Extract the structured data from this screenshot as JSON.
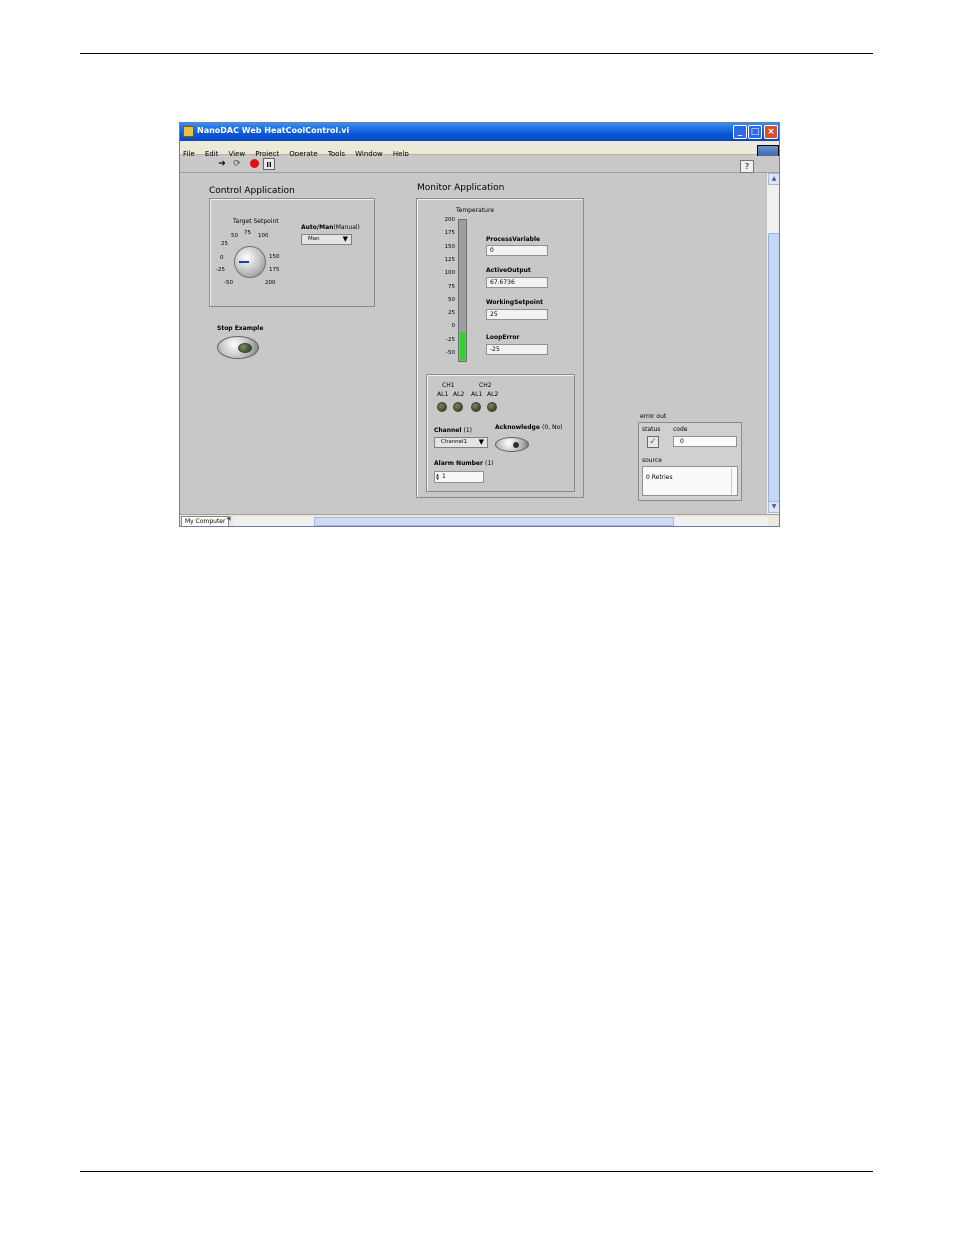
{
  "window": {
    "title": "NanoDAC Web HeatCoolControl.vi",
    "buttons": {
      "minimize": "_",
      "maximize": "□",
      "close": "×"
    }
  },
  "menu": [
    "File",
    "Edit",
    "View",
    "Project",
    "Operate",
    "Tools",
    "Window",
    "Help"
  ],
  "toolbar": {
    "run_glyph": "➔",
    "run_cont_glyph": "⟳",
    "pause_glyph": "II",
    "help_glyph": "?"
  },
  "control_app": {
    "heading": "Control Application",
    "knob": {
      "label": "Target Setpoint",
      "ticks": [
        "-50",
        "-25",
        "0",
        "25",
        "50",
        "75",
        "100",
        "150",
        "175",
        "200"
      ],
      "value": 0
    },
    "auto_man": {
      "label": "Auto/Man",
      "label_suffix": "(Manual)",
      "value": "Man"
    },
    "stop": {
      "label": "Stop Example"
    }
  },
  "monitor_app": {
    "heading": "Monitor Application",
    "tank": {
      "label": "Temperature",
      "scale": [
        "200",
        "175",
        "150",
        "125",
        "100",
        "75",
        "50",
        "25",
        "0",
        "-25",
        "-50"
      ],
      "value": 0,
      "range": [
        -50,
        200
      ]
    },
    "indicators": [
      {
        "label": "ProcessVariable",
        "value": "0"
      },
      {
        "label": "ActiveOutput",
        "value": "67.6736"
      },
      {
        "label": "WorkingSetpoint",
        "value": "25"
      },
      {
        "label": "LoopError",
        "value": "-25"
      }
    ],
    "alarms": {
      "ch1": "CH1",
      "ch2": "CH2",
      "led_labels": [
        "AL1",
        "AL2",
        "AL1",
        "AL2"
      ],
      "channel": {
        "label": "Channel",
        "label_suffix": "(1)",
        "value": "Channel1"
      },
      "acknowledge": {
        "label": "Acknowledge",
        "label_suffix": "(0, No)"
      },
      "alarm_number": {
        "label": "Alarm Number",
        "label_suffix": "(1)",
        "value": "1"
      }
    }
  },
  "error_out": {
    "label": "error out",
    "status_label": "status",
    "code_label": "code",
    "code_value": "0",
    "source_label": "source",
    "source_value": "0 Retries"
  },
  "statusbar": {
    "location": "My Computer"
  }
}
